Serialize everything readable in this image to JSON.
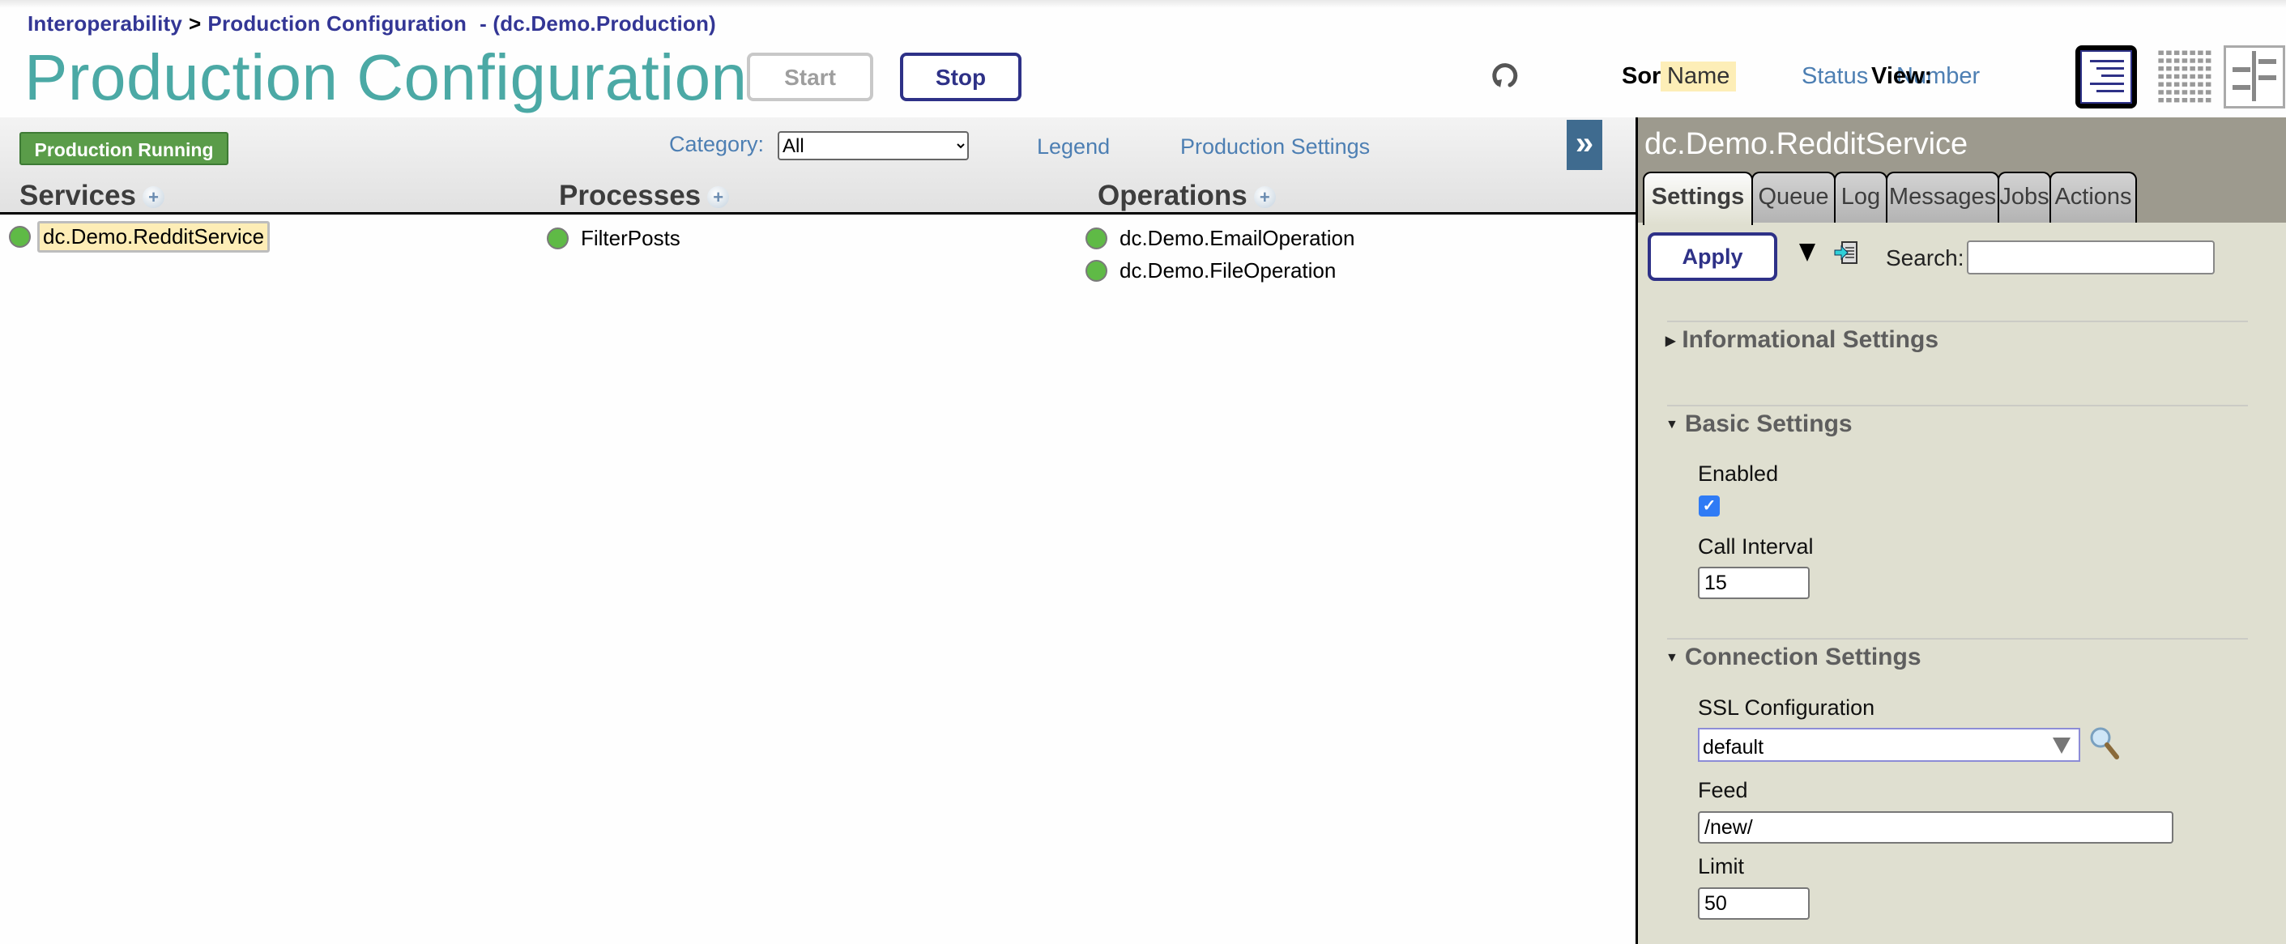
{
  "header": {
    "breadcrumb": {
      "items": [
        "Interoperability",
        "Production Configuration"
      ],
      "separator": ">",
      "production": "- (dc.Demo.Production)"
    },
    "title": "Production Configuration",
    "start_label": "Start",
    "stop_label": "Stop",
    "sort": {
      "label": "Sort:",
      "options": [
        "Name",
        "Status",
        "Number"
      ],
      "selected": "Name"
    },
    "view": {
      "label": "View:",
      "icons": [
        "list-view-icon",
        "grid-view-icon",
        "tree-view-icon"
      ],
      "selected": "list-view-icon"
    }
  },
  "toolbar": {
    "status_badge": "Production Running",
    "category_label": "Category:",
    "category_value": "All",
    "legend_link": "Legend",
    "production_settings_link": "Production Settings",
    "collapse_label": "»"
  },
  "columns": [
    {
      "title": "Services",
      "items": [
        {
          "name": "dc.Demo.RedditService",
          "status": "running",
          "selected": true
        }
      ]
    },
    {
      "title": "Processes",
      "items": [
        {
          "name": "FilterPosts",
          "status": "running",
          "selected": false
        }
      ]
    },
    {
      "title": "Operations",
      "items": [
        {
          "name": "dc.Demo.EmailOperation",
          "status": "running",
          "selected": false
        },
        {
          "name": "dc.Demo.FileOperation",
          "status": "running",
          "selected": false
        }
      ]
    }
  ],
  "colors": {
    "brand_title": "#4ba9a5",
    "brand_navy": "#2e3187",
    "link_blue": "#4d7fb3",
    "status_running": "#5fba46",
    "badge_green": "#5a9c49",
    "panel_bg": "#dfdfd0",
    "panel_header": "#9d9a8e"
  },
  "panel": {
    "title": "dc.Demo.RedditService",
    "tabs": [
      "Settings",
      "Queue",
      "Log",
      "Messages",
      "Jobs",
      "Actions"
    ],
    "active_tab": "Settings",
    "apply_label": "Apply",
    "search_label": "Search:",
    "search_value": "",
    "sections": [
      {
        "title": "Informational Settings",
        "expanded": false
      },
      {
        "title": "Basic Settings",
        "expanded": true,
        "fields": [
          {
            "label": "Enabled",
            "type": "checkbox",
            "checked": true
          },
          {
            "label": "Call Interval",
            "type": "text",
            "value": "15"
          }
        ]
      },
      {
        "title": "Connection Settings",
        "expanded": true,
        "fields": [
          {
            "label": "SSL Configuration",
            "type": "combo",
            "value": "default"
          },
          {
            "label": "Feed",
            "type": "text",
            "value": "/new/"
          },
          {
            "label": "Limit",
            "type": "text",
            "value": "50"
          }
        ]
      }
    ]
  }
}
